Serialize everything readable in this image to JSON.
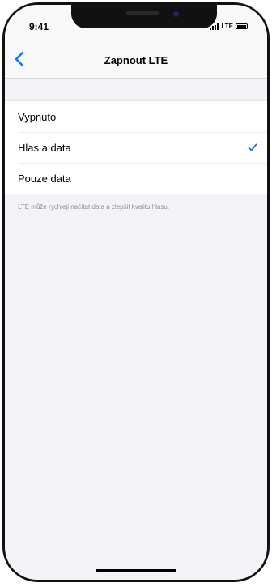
{
  "status_bar": {
    "time": "9:41",
    "network": "LTE"
  },
  "nav": {
    "title": "Zapnout LTE",
    "back_icon": "chevron-left-icon"
  },
  "options": [
    {
      "label": "Vypnuto",
      "selected": false
    },
    {
      "label": "Hlas a data",
      "selected": true
    },
    {
      "label": "Pouze data",
      "selected": false
    }
  ],
  "footer_note": "LTE může rychleji načítat data a zlepšit kvalitu hlasu.",
  "colors": {
    "accent": "#007aff",
    "background": "#f2f2f7",
    "footer_text": "#8e8e93"
  }
}
